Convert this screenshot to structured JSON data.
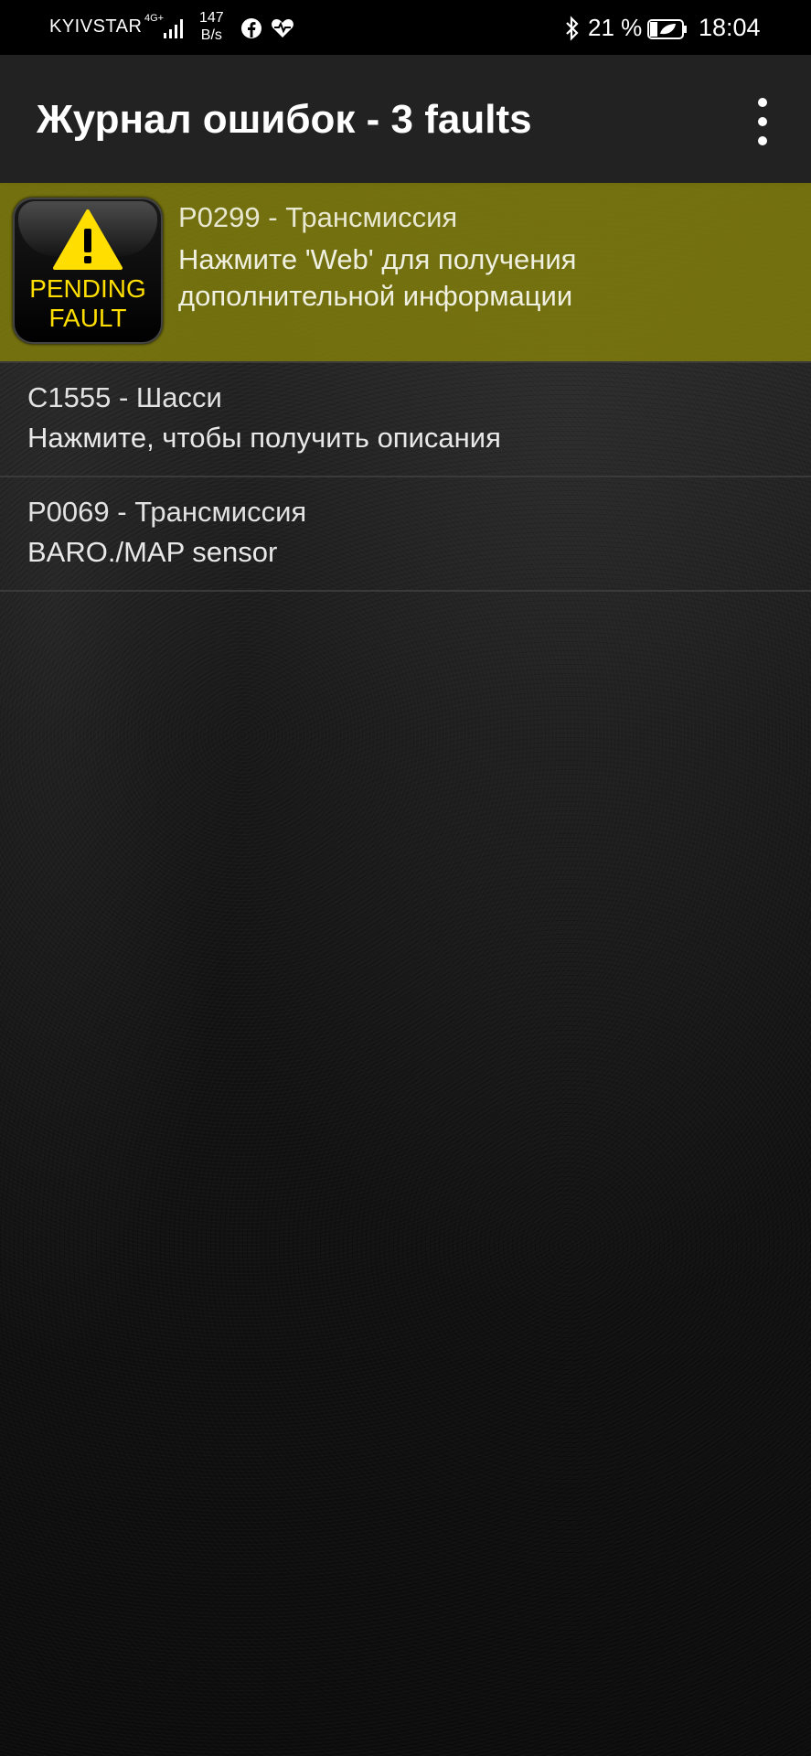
{
  "status_bar": {
    "carrier": "KYIVSTAR",
    "network": "4G+",
    "speed_value": "147",
    "speed_unit": "B/s",
    "battery_percent": "21 %",
    "time": "18:04",
    "icons": [
      "signal-icon",
      "facebook-icon",
      "health-icon",
      "bluetooth-icon",
      "battery-saver-icon"
    ]
  },
  "app_bar": {
    "title": "Журнал ошибок - 3 faults",
    "menu_icon": "overflow-menu-icon"
  },
  "faults": [
    {
      "title": "P0299 - Трансмиссия",
      "description": "Нажмите 'Web' для получения дополнительной информации",
      "badge_line1": "PENDING",
      "badge_line2": "FAULT",
      "badge_icon": "warning-triangle-icon",
      "highlighted": true
    },
    {
      "title": "C1555 - Шасси",
      "description": "Нажмите, чтобы получить описания",
      "highlighted": false
    },
    {
      "title": "P0069 - Трансмиссия",
      "description": "BARO./MAP sensor",
      "highlighted": false
    }
  ],
  "colors": {
    "highlight_row": "#84800a",
    "badge_text": "#ffde00",
    "app_bar": "#222222",
    "status_bar": "#000000"
  }
}
